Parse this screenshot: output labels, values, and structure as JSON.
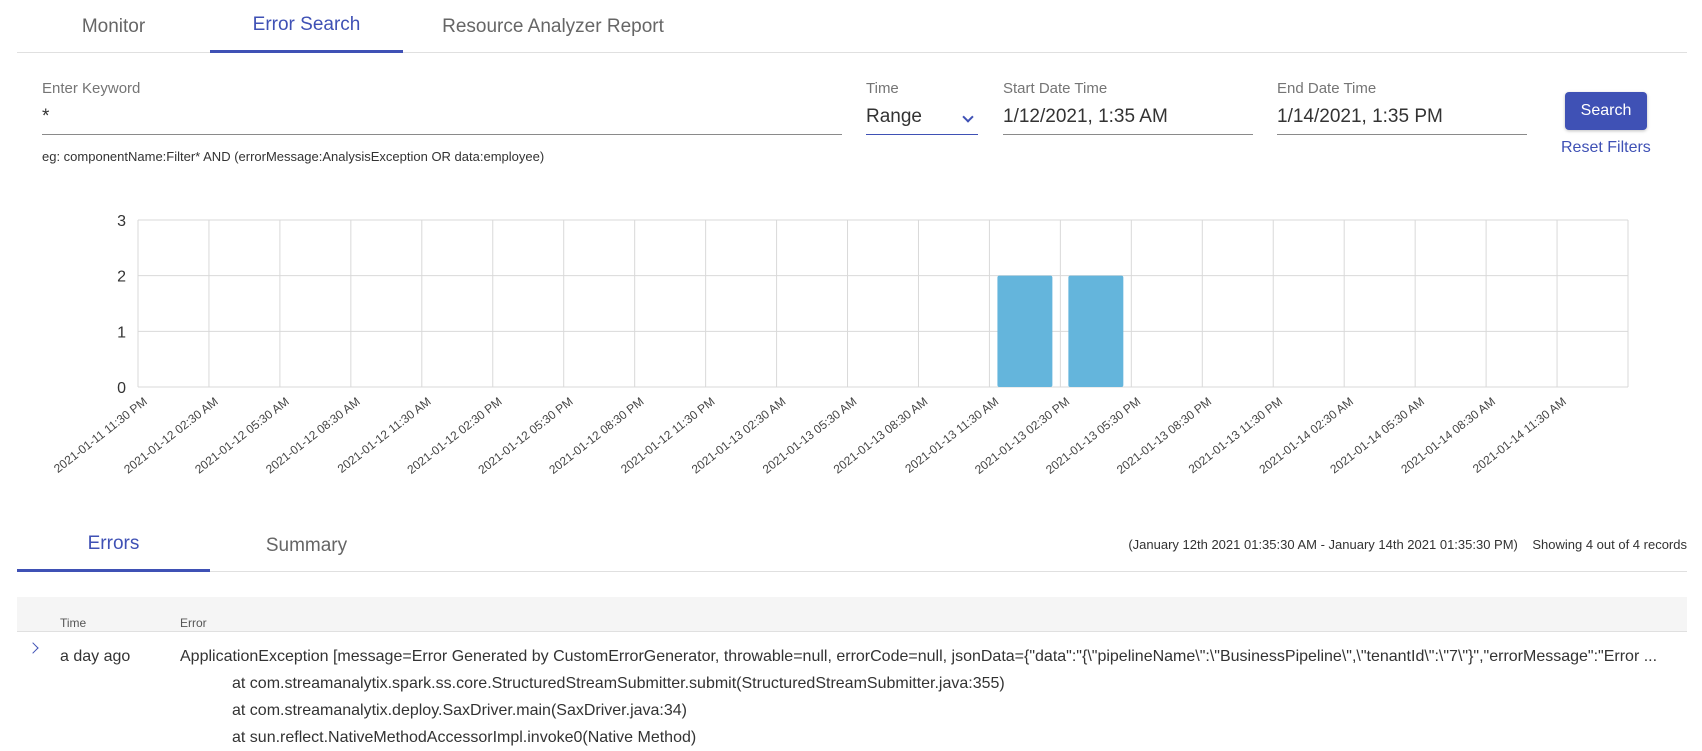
{
  "top_tabs": [
    {
      "label": "Monitor",
      "active": false
    },
    {
      "label": "Error Search",
      "active": true
    },
    {
      "label": "Resource Analyzer Report",
      "active": false
    }
  ],
  "form": {
    "keyword_label": "Enter Keyword",
    "keyword_value": "*",
    "hint": "eg: componentName:Filter* AND (errorMessage:AnalysisException OR data:employee)",
    "time_label": "Time",
    "time_value": "Range",
    "start_label": "Start Date Time",
    "start_value": "1/12/2021, 1:35 AM",
    "end_label": "End Date Time",
    "end_value": "1/14/2021, 1:35 PM",
    "search_label": "Search",
    "reset_label": "Reset Filters"
  },
  "chart_data": {
    "type": "bar",
    "title": "",
    "xlabel": "",
    "ylabel": "",
    "ylim": [
      0,
      3
    ],
    "yticks": [
      0,
      1,
      2,
      3
    ],
    "grid": true,
    "bar_color": "#64b5dc",
    "categories": [
      "2021-01-11 11:30 PM",
      "2021-01-12 02:30 AM",
      "2021-01-12 05:30 AM",
      "2021-01-12 08:30 AM",
      "2021-01-12 11:30 AM",
      "2021-01-12 02:30 PM",
      "2021-01-12 05:30 PM",
      "2021-01-12 08:30 PM",
      "2021-01-12 11:30 PM",
      "2021-01-13 02:30 AM",
      "2021-01-13 05:30 AM",
      "2021-01-13 08:30 AM",
      "2021-01-13 11:30 AM",
      "2021-01-13 02:30 PM",
      "2021-01-13 05:30 PM",
      "2021-01-13 08:30 PM",
      "2021-01-13 11:30 PM",
      "2021-01-14 02:30 AM",
      "2021-01-14 05:30 AM",
      "2021-01-14 08:30 AM",
      "2021-01-14 11:30 AM"
    ],
    "values": [
      0,
      0,
      0,
      0,
      0,
      0,
      0,
      0,
      0,
      0,
      0,
      0,
      2,
      2,
      0,
      0,
      0,
      0,
      0,
      0,
      0
    ]
  },
  "bottom_tabs": [
    {
      "label": "Errors",
      "active": true
    },
    {
      "label": "Summary",
      "active": false
    }
  ],
  "range_text": "(January 12th 2021 01:35:30 AM - January 14th 2021 01:35:30 PM)",
  "records_text": "Showing 4 out of 4 records",
  "table": {
    "columns": [
      "Time",
      "Error"
    ],
    "rows": [
      {
        "time": "a day ago",
        "error_lines": [
          "ApplicationException [message=Error Generated by CustomErrorGenerator, throwable=null, errorCode=null, jsonData={\"data\":\"{\\\"pipelineName\\\":\\\"BusinessPipeline\\\",\\\"tenantId\\\":\\\"7\\\"}\",\"errorMessage\":\"Error ...",
          "at com.streamanalytix.spark.ss.core.StructuredStreamSubmitter.submit(StructuredStreamSubmitter.java:355)",
          "at com.streamanalytix.deploy.SaxDriver.main(SaxDriver.java:34)",
          "at sun.reflect.NativeMethodAccessorImpl.invoke0(Native Method)"
        ]
      }
    ]
  }
}
